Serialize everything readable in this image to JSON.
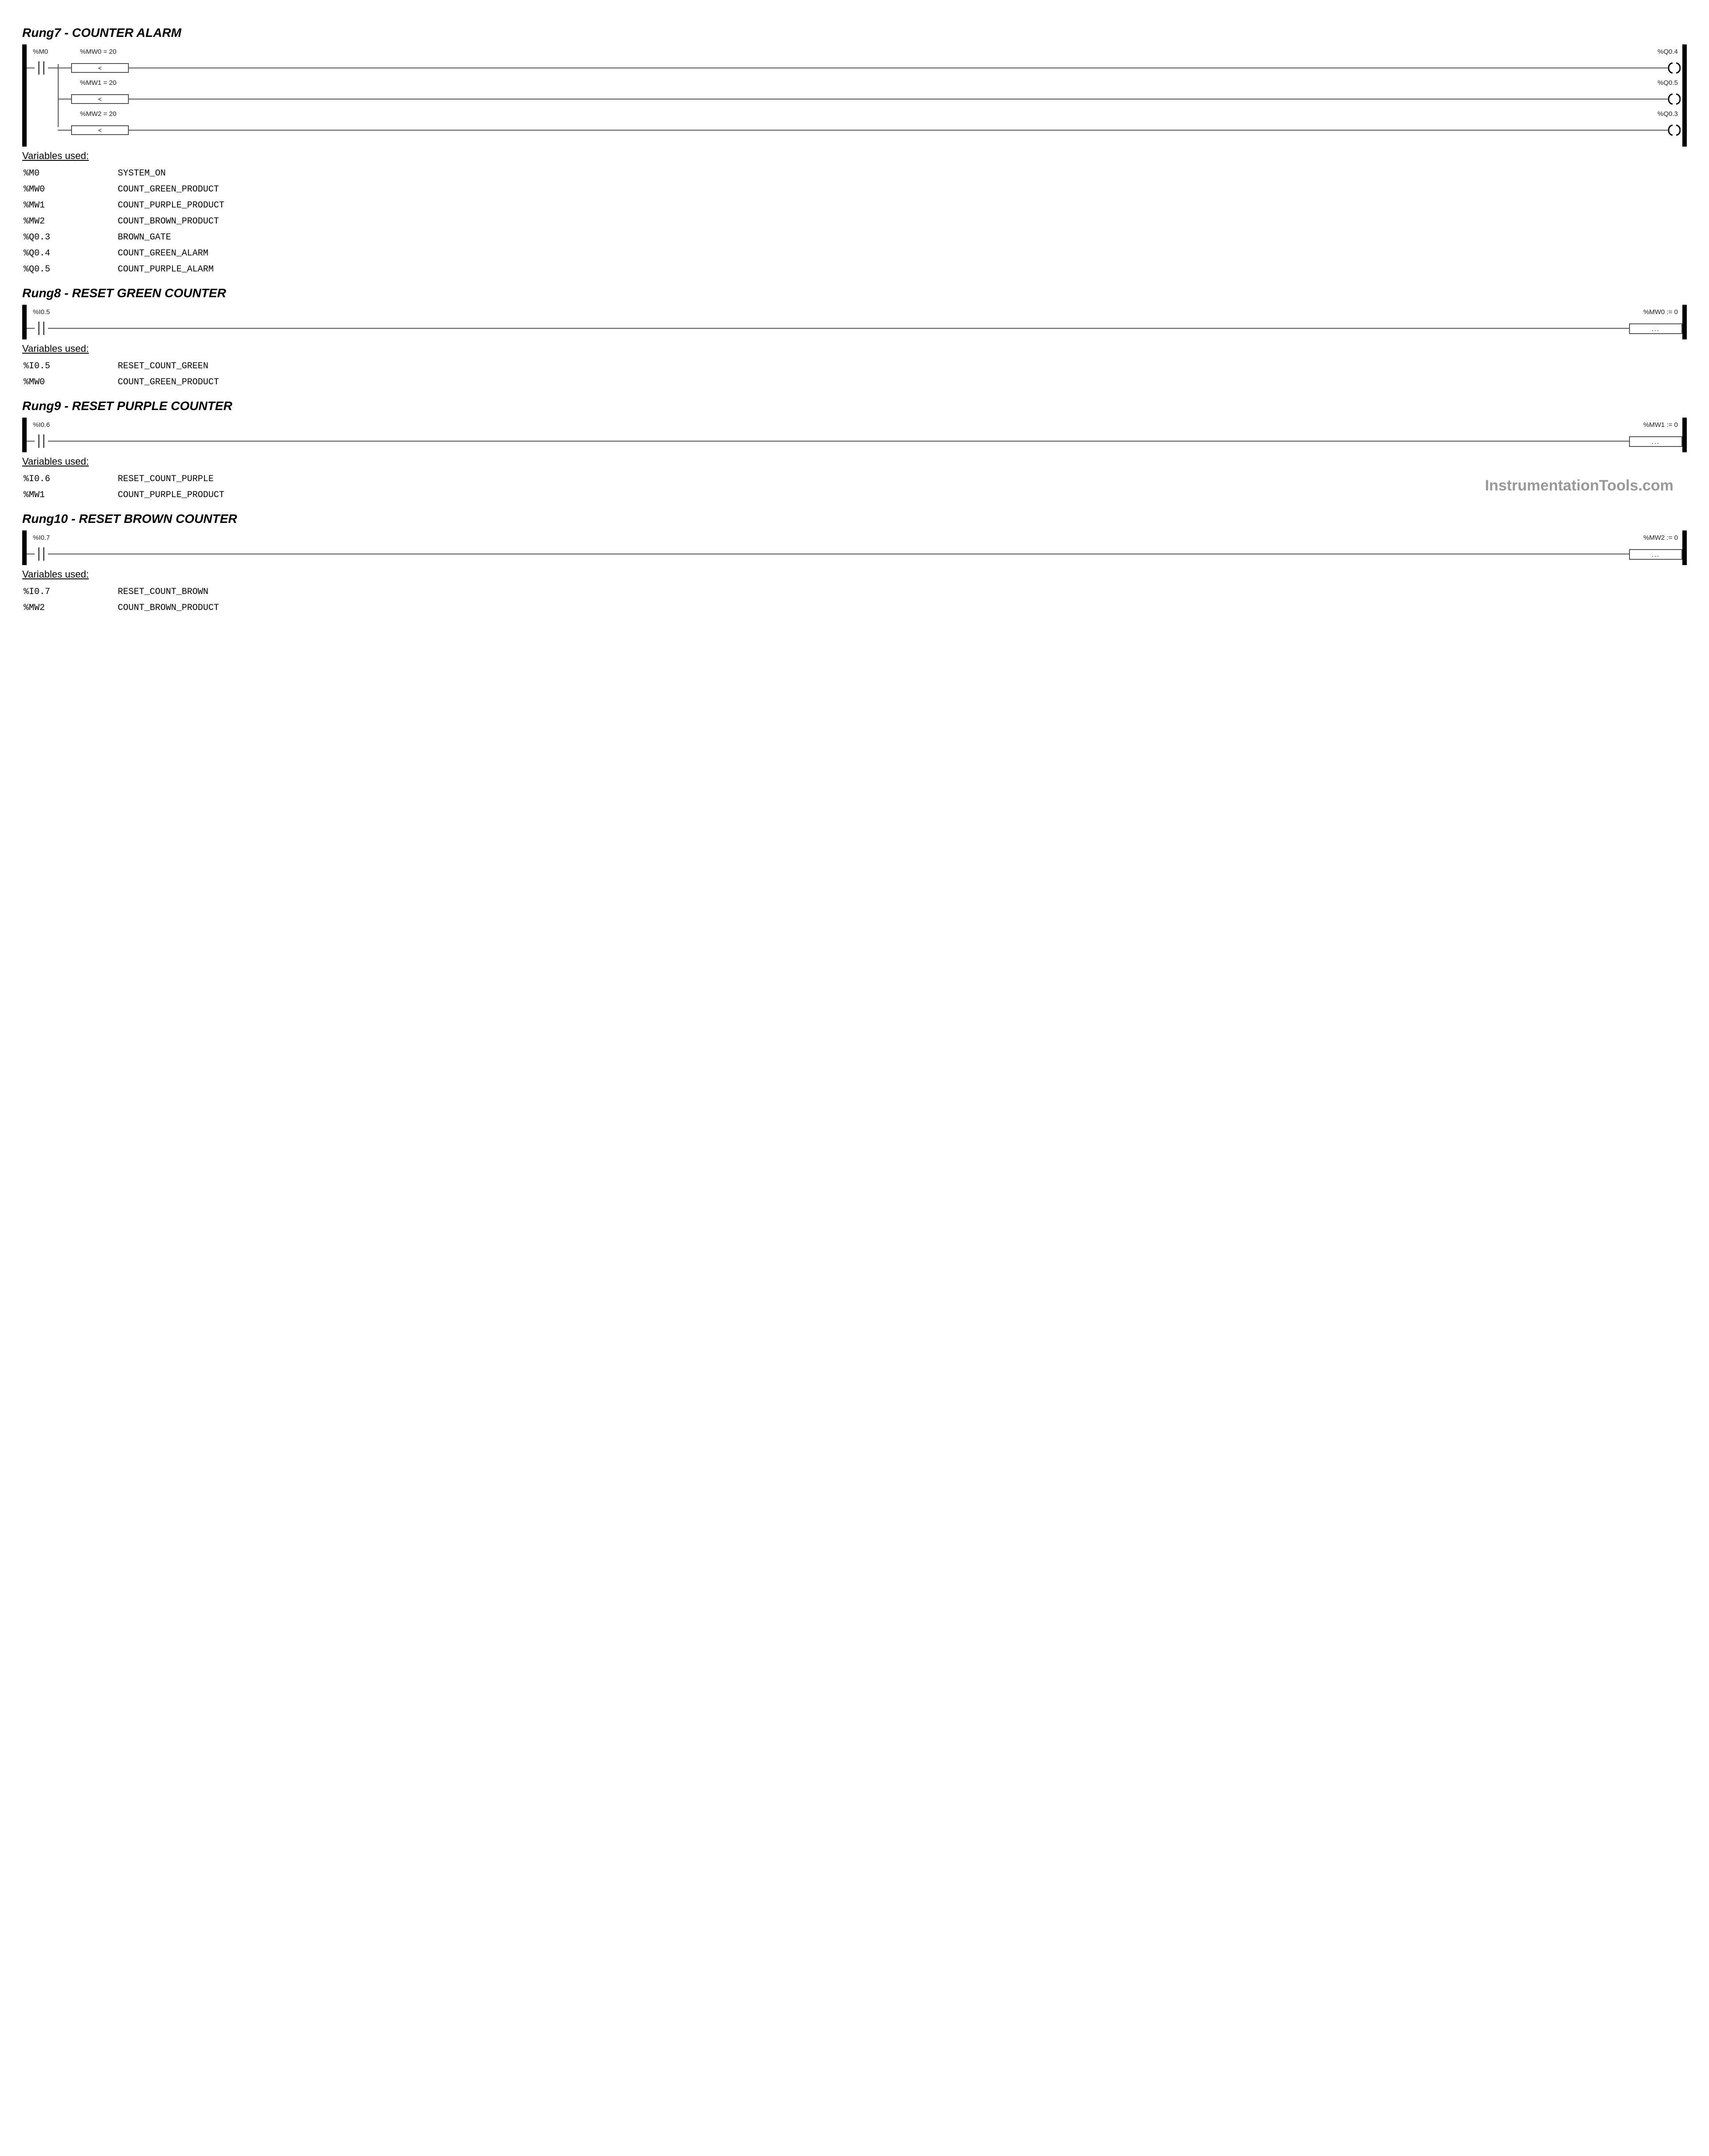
{
  "watermark": "InstrumentationTools.com",
  "rungs": {
    "r7": {
      "title": "Rung7 - COUNTER ALARM",
      "m0_label": "%M0",
      "branch1_cond": "%MW0 = 20",
      "branch1_out": "%Q0.4",
      "branch2_cond": "%MW1 = 20",
      "branch2_out": "%Q0.5",
      "branch3_cond": "%MW2 = 20",
      "branch3_out": "%Q0.3",
      "cmp_symbol": "<",
      "vars_title": "Variables used:",
      "vars": [
        {
          "addr": "%M0",
          "name": "SYSTEM_ON"
        },
        {
          "addr": "%MW0",
          "name": "COUNT_GREEN_PRODUCT"
        },
        {
          "addr": "%MW1",
          "name": "COUNT_PURPLE_PRODUCT"
        },
        {
          "addr": "%MW2",
          "name": "COUNT_BROWN_PRODUCT"
        },
        {
          "addr": "%Q0.3",
          "name": "BROWN_GATE"
        },
        {
          "addr": "%Q0.4",
          "name": "COUNT_GREEN_ALARM"
        },
        {
          "addr": "%Q0.5",
          "name": "COUNT_PURPLE_ALARM"
        }
      ]
    },
    "r8": {
      "title": "Rung8 - RESET GREEN COUNTER",
      "in_label": "%I0.5",
      "out_label": "%MW0 := 0",
      "op_content": "...",
      "vars_title": "Variables used:",
      "vars": [
        {
          "addr": "%I0.5",
          "name": "RESET_COUNT_GREEN"
        },
        {
          "addr": "%MW0",
          "name": "COUNT_GREEN_PRODUCT"
        }
      ]
    },
    "r9": {
      "title": "Rung9 - RESET PURPLE COUNTER",
      "in_label": "%I0.6",
      "out_label": "%MW1 := 0",
      "op_content": "...",
      "vars_title": "Variables used:",
      "vars": [
        {
          "addr": "%I0.6",
          "name": "RESET_COUNT_PURPLE"
        },
        {
          "addr": "%MW1",
          "name": "COUNT_PURPLE_PRODUCT"
        }
      ]
    },
    "r10": {
      "title": "Rung10 - RESET BROWN COUNTER",
      "in_label": "%I0.7",
      "out_label": "%MW2 := 0",
      "op_content": "...",
      "vars_title": "Variables used:",
      "vars": [
        {
          "addr": "%I0.7",
          "name": "RESET_COUNT_BROWN"
        },
        {
          "addr": "%MW2",
          "name": "COUNT_BROWN_PRODUCT"
        }
      ]
    }
  },
  "chart_data": {
    "type": "table",
    "title": "PLC Ladder Logic — Rungs 7-10",
    "rungs": [
      {
        "id": 7,
        "name": "COUNTER ALARM",
        "logic": [
          {
            "if": "%M0 AND (%MW0 = 20)",
            "then": "%Q0.4"
          },
          {
            "if": "%M0 AND (%MW1 = 20)",
            "then": "%Q0.5"
          },
          {
            "if": "%M0 AND (%MW2 = 20)",
            "then": "%Q0.3"
          }
        ]
      },
      {
        "id": 8,
        "name": "RESET GREEN COUNTER",
        "logic": [
          {
            "if": "%I0.5",
            "then": "%MW0 := 0"
          }
        ]
      },
      {
        "id": 9,
        "name": "RESET PURPLE COUNTER",
        "logic": [
          {
            "if": "%I0.6",
            "then": "%MW1 := 0"
          }
        ]
      },
      {
        "id": 10,
        "name": "RESET BROWN COUNTER",
        "logic": [
          {
            "if": "%I0.7",
            "then": "%MW2 := 0"
          }
        ]
      }
    ],
    "symbols": {
      "%M0": "SYSTEM_ON",
      "%MW0": "COUNT_GREEN_PRODUCT",
      "%MW1": "COUNT_PURPLE_PRODUCT",
      "%MW2": "COUNT_BROWN_PRODUCT",
      "%Q0.3": "BROWN_GATE",
      "%Q0.4": "COUNT_GREEN_ALARM",
      "%Q0.5": "COUNT_PURPLE_ALARM",
      "%I0.5": "RESET_COUNT_GREEN",
      "%I0.6": "RESET_COUNT_PURPLE",
      "%I0.7": "RESET_COUNT_BROWN"
    }
  }
}
